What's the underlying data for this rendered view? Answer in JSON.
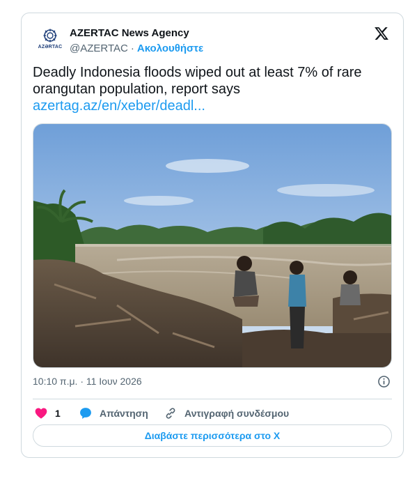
{
  "account": {
    "name": "AZERTAC News Agency",
    "handle": "@AZERTAC",
    "separator": "·",
    "follow_label": "Ακολουθήστε",
    "avatar_brand": "AZƏRTAC"
  },
  "tweet": {
    "text": "Deadly Indonesia floods wiped out at least 7% of rare orangutan population, report says",
    "link": "azertag.az/en/xeber/deadl..."
  },
  "media": {
    "description_icon": "photo"
  },
  "meta": {
    "timestamp": "10:10 π.μ. · 11 Ιουν 2026"
  },
  "actions": {
    "like_count": "1",
    "reply_label": "Απάντηση",
    "copy_link_label": "Αντιγραφή συνδέσμου"
  },
  "footer": {
    "read_more_label": "Διαβάστε περισσότερα στο X"
  },
  "colors": {
    "accent": "#1d9bf0",
    "like": "#f91880",
    "secondary_text": "#536471",
    "border": "#cfd9de"
  },
  "icons": {
    "brand": "x-logo-icon",
    "info": "info-icon",
    "like": "heart-icon",
    "reply": "speech-bubble-icon",
    "copy": "link-icon"
  }
}
